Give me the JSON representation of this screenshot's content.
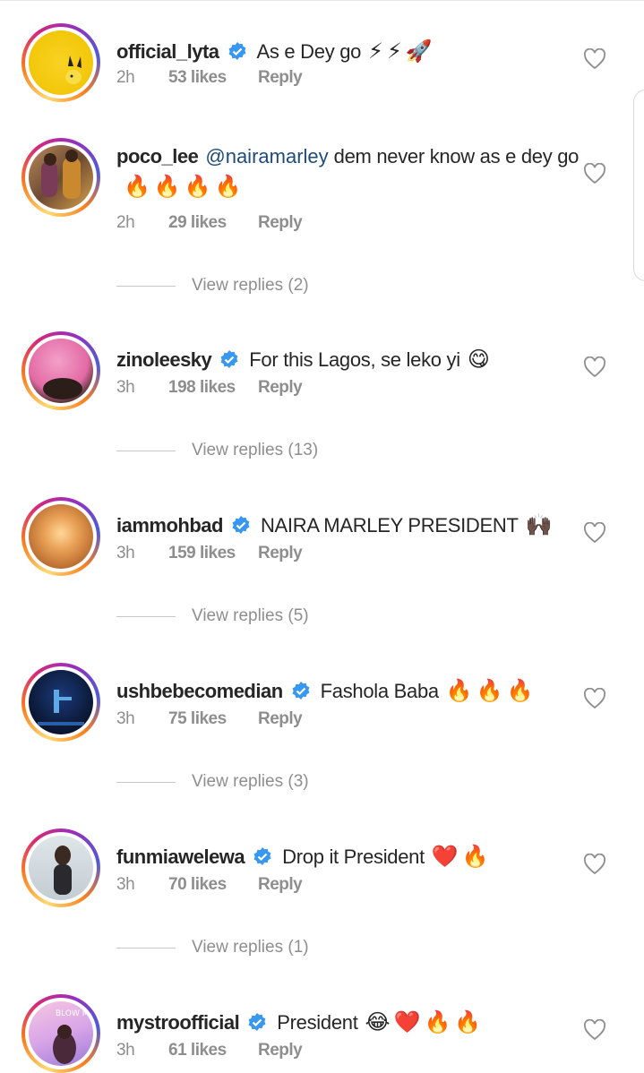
{
  "comments": [
    {
      "username": "official_lyta",
      "verified": true,
      "mention": "",
      "text": "As e Dey go",
      "emojis": "⚡⚡🚀",
      "time": "2h",
      "likes": "53 likes",
      "reply": "Reply",
      "view_replies": "",
      "avatar": "pikachu"
    },
    {
      "username": "poco_lee",
      "verified": false,
      "mention": "@nairamarley",
      "text": "dem never know as e dey go",
      "emojis": "🔥🔥🔥🔥",
      "time": "2h",
      "likes": "29 likes",
      "reply": "Reply",
      "view_replies": "View replies (2)",
      "avatar": "couple"
    },
    {
      "username": "zinoleesky",
      "verified": true,
      "mention": "",
      "text": "For this Lagos, se leko yi",
      "emojis": "😋",
      "time": "3h",
      "likes": "198 likes",
      "reply": "Reply",
      "view_replies": "View replies (13)",
      "avatar": "pink-hair"
    },
    {
      "username": "iammohbad",
      "verified": true,
      "mention": "",
      "text": "NAIRA MARLEY PRESIDENT",
      "emojis": "🙌🏿",
      "time": "3h",
      "likes": "159 likes",
      "reply": "Reply",
      "view_replies": "View replies (5)",
      "avatar": "sunset"
    },
    {
      "username": "ushbebecomedian",
      "verified": true,
      "mention": "",
      "text": "Fashola Baba",
      "emojis": "🔥🔥🔥",
      "time": "3h",
      "likes": "75 likes",
      "reply": "Reply",
      "view_replies": "View replies (3)",
      "avatar": "stage"
    },
    {
      "username": "funmiawelewa",
      "verified": true,
      "mention": "",
      "text": "Drop it President",
      "emojis": "❤️🔥",
      "time": "3h",
      "likes": "70 likes",
      "reply": "Reply",
      "view_replies": "View replies (1)",
      "avatar": "portrait"
    },
    {
      "username": "mystroofficial",
      "verified": true,
      "mention": "",
      "text": "President",
      "emojis": "😂❤️🔥🔥",
      "time": "3h",
      "likes": "61 likes",
      "reply": "Reply",
      "view_replies": "",
      "avatar": "cover"
    }
  ],
  "colors": {
    "verified": "#3897f0",
    "mention": "#1e4b7a",
    "meta": "#8e8e8e"
  },
  "icons": {
    "like": "heart-outline-icon",
    "badge": "verified-badge-icon"
  }
}
